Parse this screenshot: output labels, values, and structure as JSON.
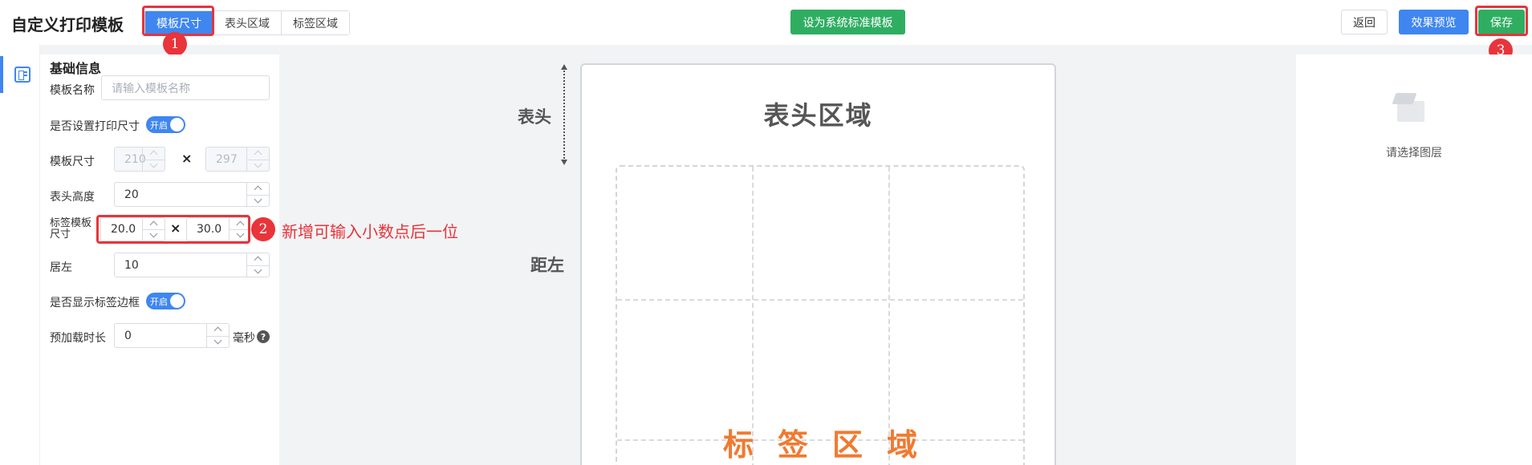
{
  "header": {
    "title": "自定义打印模板",
    "tabs": [
      {
        "label": "模板尺寸",
        "active": true
      },
      {
        "label": "表头区域",
        "active": false
      },
      {
        "label": "标签区域",
        "active": false
      }
    ],
    "set_standard_label": "设为系统标准模板",
    "back_label": "返回",
    "preview_label": "效果预览",
    "save_label": "保存"
  },
  "badges": [
    "1",
    "2",
    "3"
  ],
  "form": {
    "section_title": "基础信息",
    "template_name_label": "模板名称",
    "template_name_placeholder": "请输入模板名称",
    "set_print_size_label": "是否设置打印尺寸",
    "switch_on_text": "开启",
    "template_size_label": "模板尺寸",
    "template_width": "210",
    "template_height": "297",
    "times": "×",
    "header_height_label": "表头高度",
    "header_height": "20",
    "label_size_label_line1": "标签模板",
    "label_size_label_line2": "尺寸",
    "label_width": "20.0",
    "label_height": "30.0",
    "left_margin_label": "居左",
    "left_margin": "10",
    "show_border_label": "是否显示标签边框",
    "preload_label": "预加载时长",
    "preload_value": "0",
    "preload_unit": "毫秒",
    "help_glyph": "?"
  },
  "annotation_text": "新增可输入小数点后一位",
  "canvas": {
    "header_side_label": "表头",
    "left_side_label": "距左",
    "header_area_title": "表头区域",
    "label_area_title": "标签区域"
  },
  "right_panel": {
    "empty_text": "请选择图层"
  },
  "colors": {
    "primary": "#3f86f0",
    "success": "#2fae62",
    "highlight": "#e8343a",
    "label_area_text": "#f07a30"
  }
}
